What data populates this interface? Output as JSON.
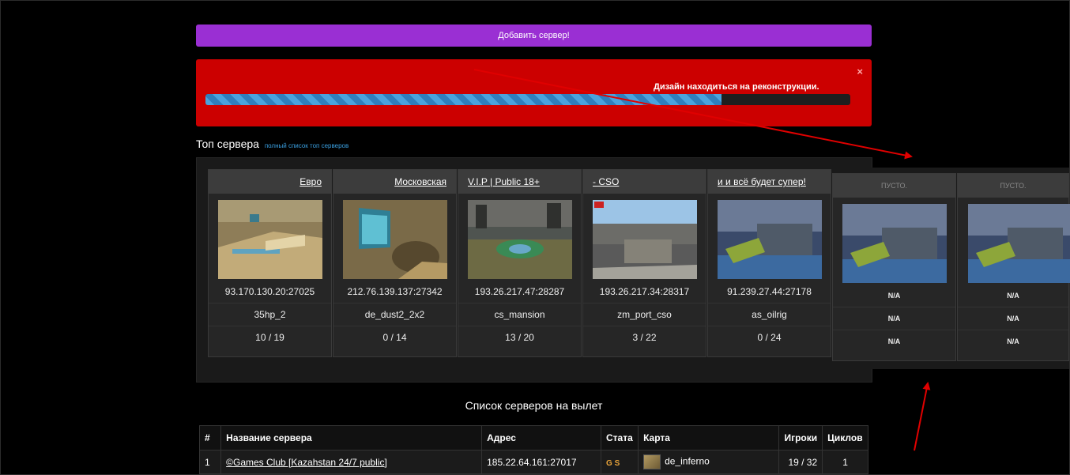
{
  "add_server_label": "Добавить сервер!",
  "alert": {
    "message": "Дизайн находиться на реконструкции.",
    "close_label": "×",
    "progress_value": 0.8
  },
  "top": {
    "title": "Топ сервера",
    "full_list_link": "полный список топ серверов"
  },
  "cards": [
    {
      "name": "Евро",
      "address": "93.170.130.20:27025",
      "map": "35hp_2",
      "players": "10 / 19"
    },
    {
      "name": "Московская",
      "address": "212.76.139.137:27342",
      "map": "de_dust2_2x2",
      "players": "0 / 14"
    },
    {
      "name": "V.I.P | Public 18+",
      "address": "193.26.217.47:28287",
      "map": "cs_mansion",
      "players": "13 / 20"
    },
    {
      "name": "- CSO",
      "address": "193.26.217.34:28317",
      "map": "zm_port_cso",
      "players": "3 / 22"
    },
    {
      "name": "и и всё будет супер!",
      "address": "91.239.27.44:27178",
      "map": "as_oilrig",
      "players": "0 / 24"
    },
    {
      "name": "ПУСТО.",
      "address": "N/A",
      "map": "N/A",
      "players": "N/A"
    },
    {
      "name": "ПУСТО.",
      "address": "N/A",
      "map": "N/A",
      "players": "N/A"
    }
  ],
  "list": {
    "title": "Список серверов на вылет",
    "columns": [
      "#",
      "Название сервера",
      "Адрес",
      "Стата",
      "Карта",
      "Игроки",
      "Циклов"
    ],
    "rows": [
      {
        "num": "1",
        "name": "©Games Club [Kazahstan 24/7 public]",
        "address": "185.22.64.161:27017",
        "stat": "G S",
        "map": "de_inferno",
        "players": "19 / 32",
        "cycles": "1"
      }
    ]
  },
  "colors": {
    "add_button": "#9a2fd3",
    "alert_bg": "#cc0000",
    "progress": "#4aa3dd",
    "arrow": "#e00000",
    "link": "#3a9fe0"
  }
}
